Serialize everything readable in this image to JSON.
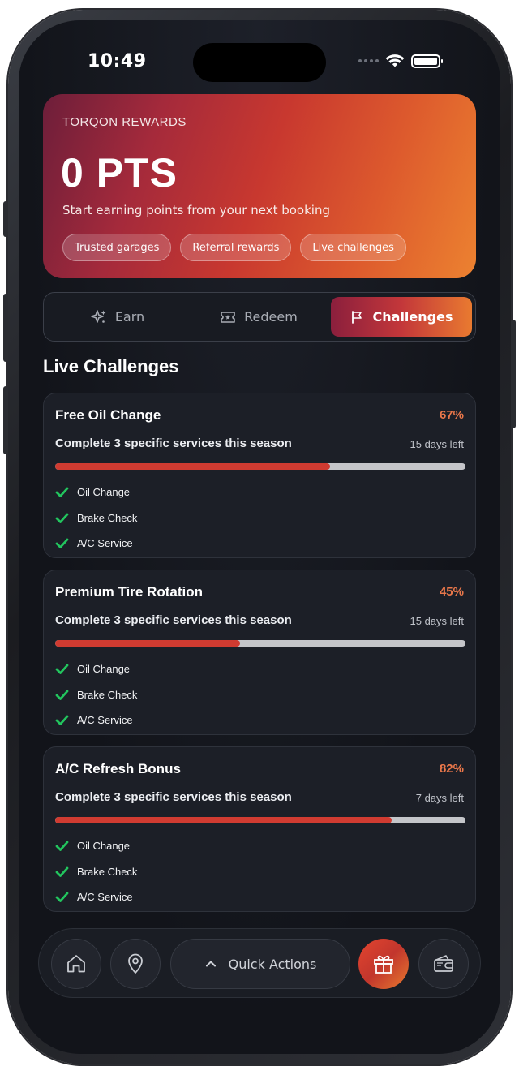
{
  "status_bar": {
    "time": "10:49"
  },
  "hero": {
    "brand": "TORQON REWARDS",
    "points": "0 PTS",
    "subtitle": "Start earning points from your next booking",
    "chips": [
      "Trusted garages",
      "Referral rewards",
      "Live challenges"
    ],
    "gradient": [
      "#6d1e3a",
      "#c8382f",
      "#ec8230"
    ]
  },
  "tabs": [
    {
      "label": "Earn",
      "icon": "sparkle-icon"
    },
    {
      "label": "Redeem",
      "icon": "ticket-icon"
    },
    {
      "label": "Challenges",
      "icon": "flag-icon",
      "active": true
    }
  ],
  "section_title": "Live Challenges",
  "challenges": [
    {
      "title": "Free Oil Change",
      "percent_label": "67%",
      "progress": 0.67,
      "description": "Complete 3 specific services this season",
      "days_left": "15 days left",
      "tasks": [
        "Oil Change",
        "Brake Check",
        "A/C Service"
      ]
    },
    {
      "title": "Premium Tire Rotation",
      "percent_label": "45%",
      "progress": 0.45,
      "description": "Complete 3 specific services this season",
      "days_left": "15 days left",
      "tasks": [
        "Oil Change",
        "Brake Check",
        "A/C Service"
      ]
    },
    {
      "title": "A/C Refresh Bonus",
      "percent_label": "82%",
      "progress": 0.82,
      "description": "Complete 3 specific services this season",
      "days_left": "7 days left",
      "tasks": [
        "Oil Change",
        "Brake Check",
        "A/C Service"
      ]
    }
  ],
  "bottom_nav": {
    "quick_actions": "Quick Actions",
    "icons": [
      "home-icon",
      "location-pin-icon",
      "chevron-up-icon",
      "gift-icon",
      "wallet-icon"
    ]
  },
  "colors": {
    "accent": "#e9774a",
    "progress": "#d03b31",
    "check": "#22c55e",
    "background": "#15181f"
  }
}
